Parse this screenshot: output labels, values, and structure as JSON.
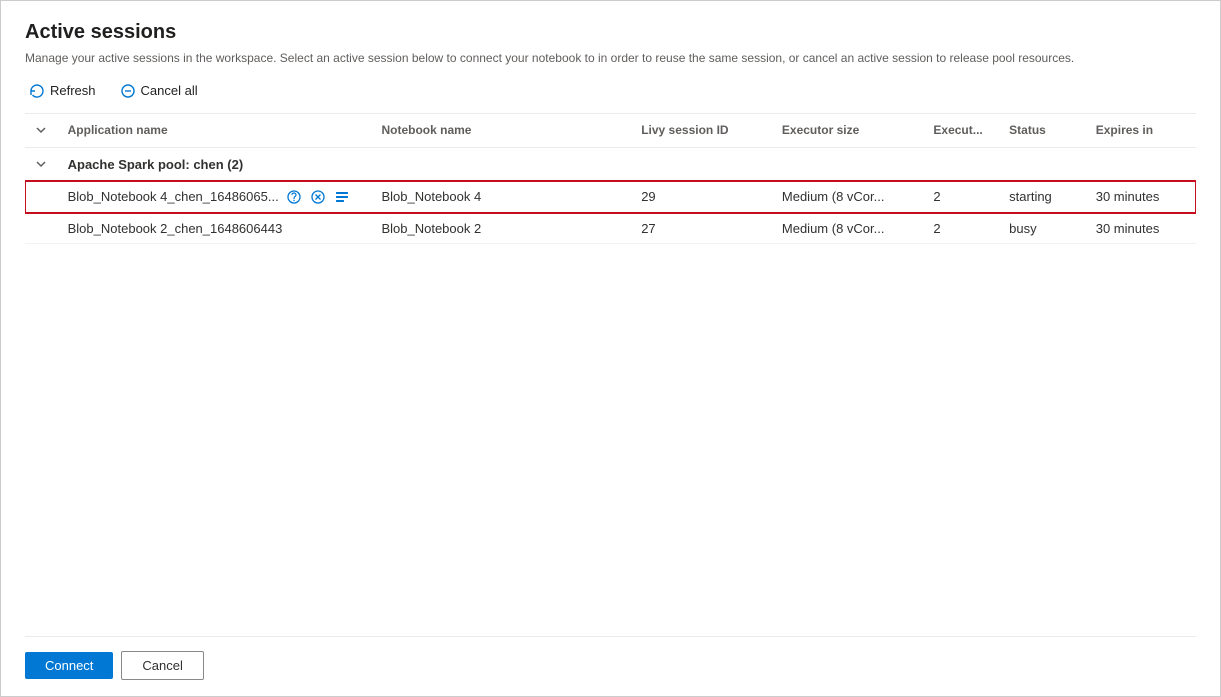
{
  "dialog": {
    "title": "Active sessions",
    "description": "Manage your active sessions in the workspace. Select an active session below to connect your notebook to in order to reuse the same session, or cancel an active session to release pool resources.",
    "toolbar": {
      "refresh_label": "Refresh",
      "cancel_all_label": "Cancel all"
    },
    "table": {
      "columns": [
        {
          "key": "chevron",
          "label": ""
        },
        {
          "key": "appname",
          "label": "Application name"
        },
        {
          "key": "notebook",
          "label": "Notebook name"
        },
        {
          "key": "livy",
          "label": "Livy session ID"
        },
        {
          "key": "executor_size",
          "label": "Executor size"
        },
        {
          "key": "executor_count",
          "label": "Execut..."
        },
        {
          "key": "status",
          "label": "Status"
        },
        {
          "key": "expires",
          "label": "Expires in"
        }
      ],
      "groups": [
        {
          "name": "Apache Spark pool: chen (2)",
          "rows": [
            {
              "appname": "Blob_Notebook 4_chen_16486065...",
              "notebook": "Blob_Notebook 4",
              "livy": "29",
              "executor_size": "Medium (8 vCor...",
              "executor_count": "2",
              "status": "starting",
              "expires": "30 minutes",
              "selected": true,
              "has_actions": true
            },
            {
              "appname": "Blob_Notebook 2_chen_1648606443",
              "notebook": "Blob_Notebook 2",
              "livy": "27",
              "executor_size": "Medium (8 vCor...",
              "executor_count": "2",
              "status": "busy",
              "expires": "30 minutes",
              "selected": false,
              "has_actions": false
            }
          ]
        }
      ]
    },
    "footer": {
      "connect_label": "Connect",
      "cancel_label": "Cancel"
    }
  }
}
